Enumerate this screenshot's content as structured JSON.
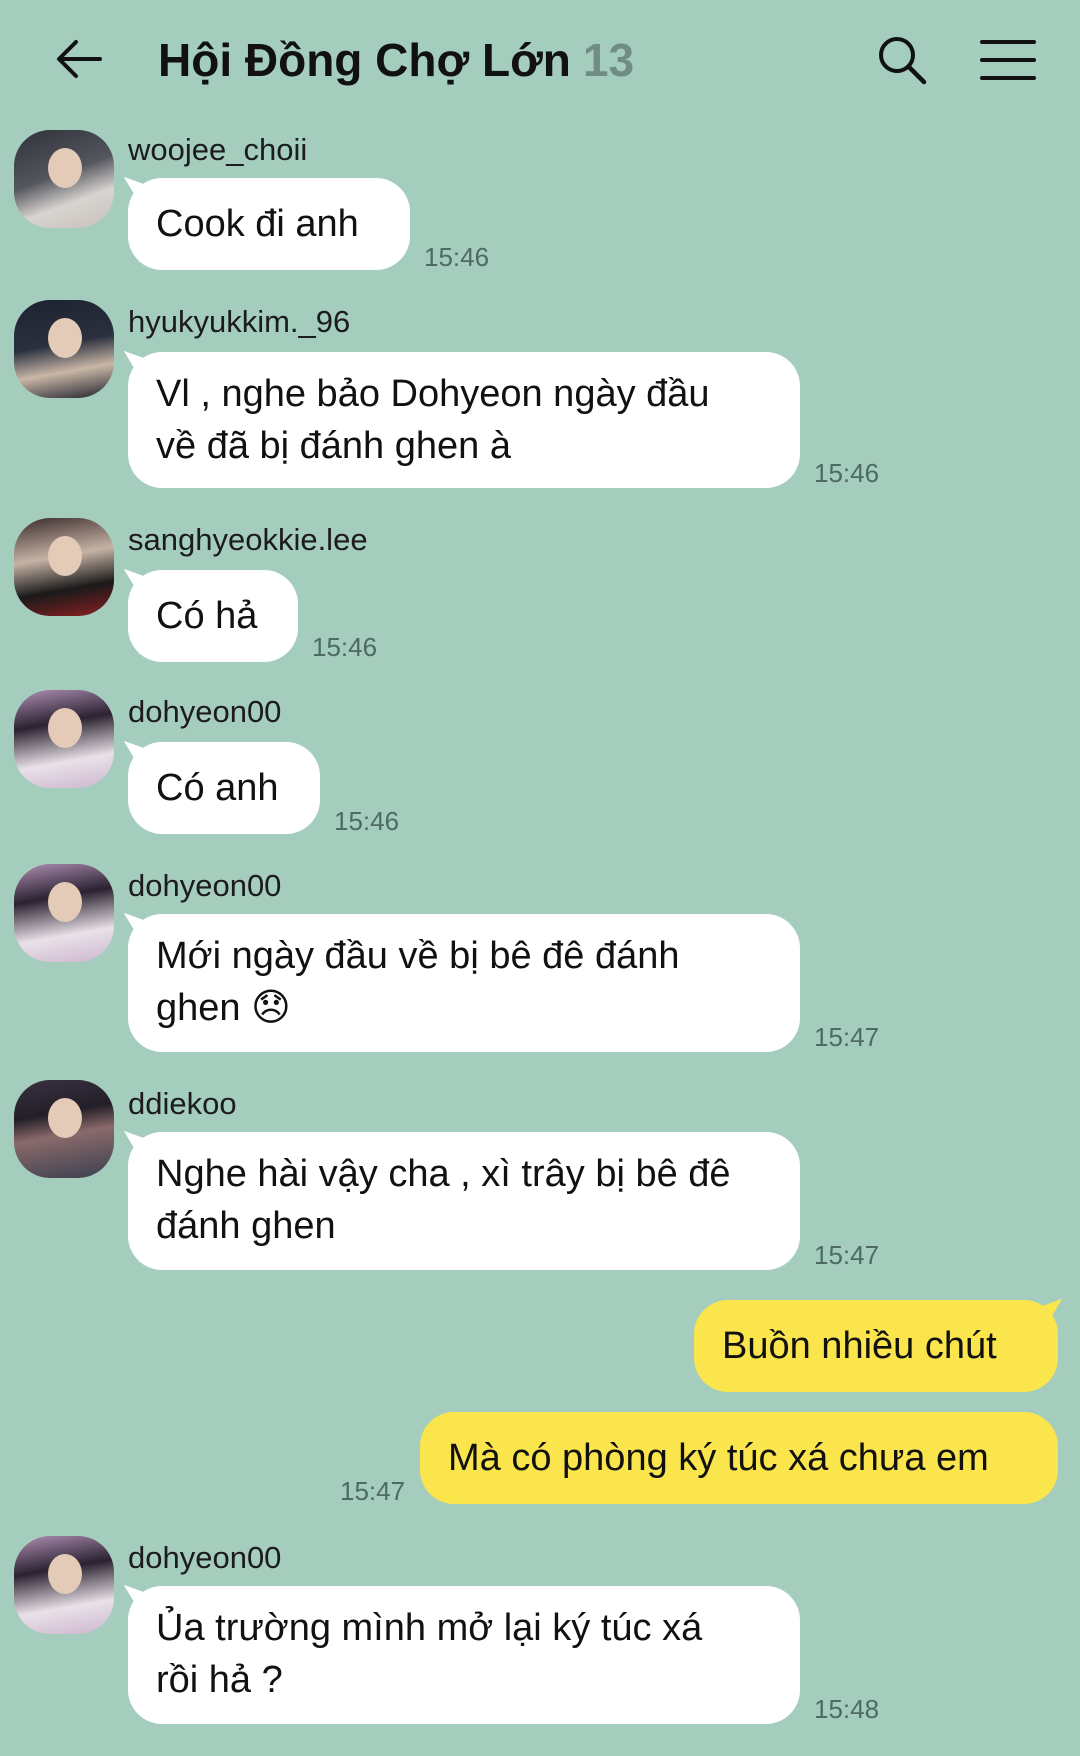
{
  "header": {
    "title": "Hội Đồng Chợ Lớn",
    "member_count": "13",
    "back_icon": "arrow-left-icon",
    "search_icon": "search-icon",
    "menu_icon": "hamburger-menu-icon"
  },
  "colors": {
    "background": "#a4cdbd",
    "incoming_bubble": "#ffffff",
    "outgoing_bubble": "#fbe54d",
    "timestamp": "#4e6a63"
  },
  "messages": [
    {
      "sender": "woojee_choii",
      "text": "Cook đi anh",
      "time": "15:46"
    },
    {
      "sender": "hyukyukkim._96",
      "text_line1": "Vl , nghe bảo Dohyeon ngày đầu",
      "text_line2": "về đã bị đánh ghen à",
      "time": "15:46"
    },
    {
      "sender": "sanghyeokkie.lee",
      "text": "Có hả",
      "time": "15:46"
    },
    {
      "sender": "dohyeon00",
      "text": "Có anh",
      "time": "15:46"
    },
    {
      "sender": "dohyeon00",
      "text_line1": "Mới ngày đầu về bị bê đê đánh",
      "text_line2": "ghen 😞",
      "time": "15:47"
    },
    {
      "sender": "ddiekoo",
      "text_line1": "Nghe hài vậy cha , xì trây bị bê đê",
      "text_line2": "đánh ghen",
      "time": "15:47"
    },
    {
      "sender": "me",
      "text": "Buồn nhiều chút",
      "time": ""
    },
    {
      "sender": "me",
      "text": "Mà có phòng ký túc xá chưa em",
      "time": "15:47"
    },
    {
      "sender": "dohyeon00",
      "text_line1": "Ủa trường mình mở lại ký túc xá",
      "text_line2": "rồi hả ?",
      "time": "15:48"
    }
  ]
}
